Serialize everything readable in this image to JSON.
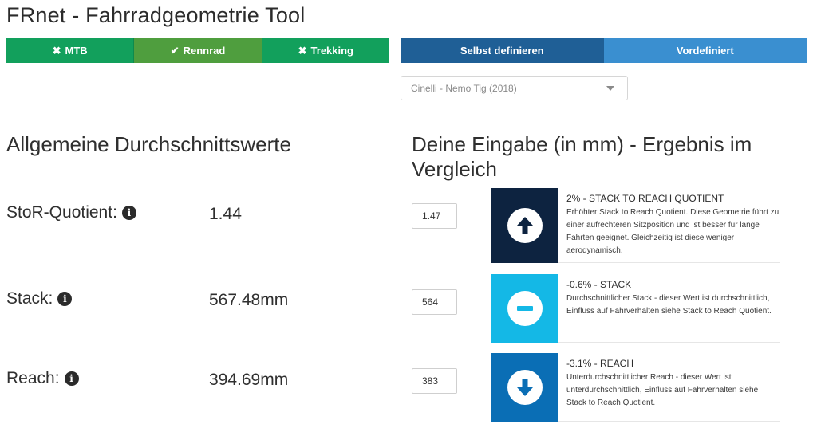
{
  "app": {
    "title": "FRnet - Fahrradgeometrie Tool"
  },
  "bike_types": [
    {
      "label": "MTB",
      "selected": false,
      "icon": "x-icon"
    },
    {
      "label": "Rennrad",
      "selected": true,
      "icon": "check-icon"
    },
    {
      "label": "Trekking",
      "selected": false,
      "icon": "x-icon"
    }
  ],
  "modes": {
    "custom_label": "Selbst definieren",
    "predefined_label": "Vordefiniert",
    "active": "custom"
  },
  "preset_select": {
    "value": "Cinelli - Nemo Tig (2018)"
  },
  "averages": {
    "heading": "Allgemeine Durchschnittswerte",
    "rows": [
      {
        "label": "StoR-Quotient:",
        "value": "1.44"
      },
      {
        "label": "Stack:",
        "value": "567.48mm"
      },
      {
        "label": "Reach:",
        "value": "394.69mm"
      }
    ]
  },
  "comparison": {
    "heading": "Deine Eingabe (in mm) - Ergebnis im Vergleich",
    "inputs": [
      "1.47",
      "564",
      "383"
    ],
    "results": [
      {
        "title": "2% - STACK TO REACH QUOTIENT",
        "description": "Erhöhter Stack to Reach Quotient. Diese Geometrie führt zu einer aufrechteren Sitzposition und ist besser für lange Fahrten geeignet. Gleichzeitig ist diese weniger aerodynamisch.",
        "icon": "arrow-up-icon",
        "color": "#0d2340"
      },
      {
        "title": "-0.6% - STACK",
        "description": "Durchschnittlicher Stack - dieser Wert ist durchschnittlich, Einfluss auf Fahrverhalten siehe Stack to Reach Quotient.",
        "icon": "minus-icon",
        "color": "#14b8e6"
      },
      {
        "title": "-3.1% - REACH",
        "description": "Unterdurchschnittlicher Reach - dieser Wert ist unterdurchschnittlich, Einfluss auf Fahrverhalten siehe Stack to Reach Quotient.",
        "icon": "arrow-down-icon",
        "color": "#0a6eb5"
      }
    ]
  }
}
